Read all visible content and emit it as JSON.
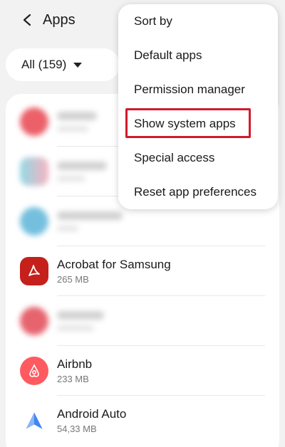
{
  "header": {
    "title": "Apps"
  },
  "filter": {
    "label": "All (159)"
  },
  "menu": {
    "items": [
      {
        "label": "Sort by"
      },
      {
        "label": "Default apps"
      },
      {
        "label": "Permission manager"
      },
      {
        "label": "Show system apps"
      },
      {
        "label": "Special access"
      },
      {
        "label": "Reset app preferences"
      }
    ],
    "highlight_color": "#d11a2a"
  },
  "apps": [
    {
      "name": "Acrobat for Samsung",
      "size": "265 MB",
      "icon": "acrobat-icon",
      "color": "#c5201b"
    },
    {
      "name": "Airbnb",
      "size": "233 MB",
      "icon": "airbnb-icon",
      "color": "#ff5a5f"
    },
    {
      "name": "Android Auto",
      "size": "54,33 MB",
      "icon": "android-auto-icon",
      "color": "#4285f4"
    }
  ]
}
